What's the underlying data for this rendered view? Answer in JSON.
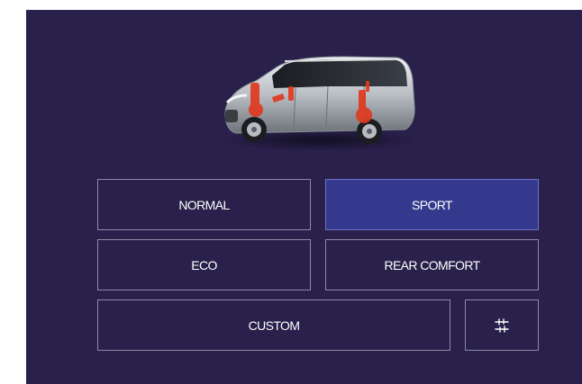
{
  "drive_modes": {
    "normal_label": "NORMAL",
    "sport_label": "SPORT",
    "eco_label": "ECO",
    "rear_comfort_label": "REAR COMFORT",
    "custom_label": "CUSTOM",
    "selected": "SPORT"
  },
  "icons": {
    "settings": "sliders-icon",
    "vehicle": "minivan-suspension-icon"
  },
  "colors": {
    "panel_background": "#29204b",
    "selected_button": "#34398e",
    "button_border": "#8f8aa6",
    "text": "#ffffff",
    "highlight_red": "#e03a1e"
  }
}
